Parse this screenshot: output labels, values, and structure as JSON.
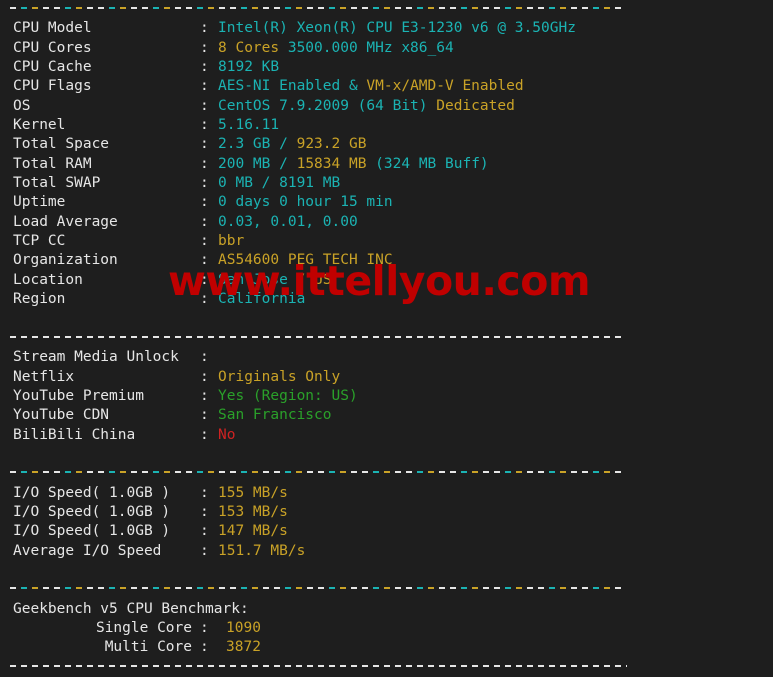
{
  "terminal": {
    "background": "#1e1e1e",
    "label_color": "#e6e6e6",
    "cyan": "#1bb3b3",
    "orange": "#c9a227",
    "green": "#2aa12a",
    "red": "#cf2222",
    "colon": ":"
  },
  "watermark": {
    "text": "www.ittellyou.com",
    "color": "#c00000"
  },
  "sysinfo": {
    "cpu_model": {
      "label": "CPU Model",
      "value": "Intel(R) Xeon(R) CPU E3-1230 v6 @ 3.50GHz"
    },
    "cpu_cores": {
      "label": "CPU Cores",
      "cores": "8 Cores",
      "freq": "3500.000 MHz x86_64"
    },
    "cpu_cache": {
      "label": "CPU Cache",
      "value": "8192 KB"
    },
    "cpu_flags": {
      "label": "CPU Flags",
      "aes": "AES-NI Enabled &",
      "vmx": " VM-x/AMD-V Enabled"
    },
    "os": {
      "label": "OS",
      "name": "CentOS 7.9.2009 (64 Bit)",
      "type": " Dedicated"
    },
    "kernel": {
      "label": "Kernel",
      "value": "5.16.11"
    },
    "total_space": {
      "label": "Total Space",
      "used": "2.3 GB",
      "slash": " / ",
      "total": "923.2 GB"
    },
    "total_ram": {
      "label": "Total RAM",
      "used": "200 MB",
      "slash": " / ",
      "total": "15834 MB",
      "buff": " (324 MB Buff)"
    },
    "total_swap": {
      "label": "Total SWAP",
      "value": "0 MB / 8191 MB"
    },
    "uptime": {
      "label": "Uptime",
      "value": "0 days 0 hour 15 min"
    },
    "load_average": {
      "label": "Load Average",
      "value": "0.03, 0.01, 0.00"
    },
    "tcp_cc": {
      "label": "TCP CC",
      "value": "bbr"
    },
    "organization": {
      "label": "Organization",
      "value": "AS54600 PEG TECH INC"
    },
    "location": {
      "label": "Location",
      "city": "San Jose",
      "slash": " / ",
      "country": "US"
    },
    "region": {
      "label": "Region",
      "value": "California"
    }
  },
  "stream_media": {
    "header": {
      "label": "Stream Media Unlock",
      "value": ""
    },
    "netflix": {
      "label": "Netflix",
      "value": "Originals Only"
    },
    "youtube_premium": {
      "label": "YouTube Premium",
      "value": "Yes (Region: US)"
    },
    "youtube_cdn": {
      "label": "YouTube CDN",
      "value": "San Francisco"
    },
    "bilibili_china": {
      "label": "BiliBili China",
      "value": "No"
    }
  },
  "io_speed": {
    "runs": [
      {
        "label": "I/O Speed( 1.0GB )",
        "value": "155 MB/s"
      },
      {
        "label": "I/O Speed( 1.0GB )",
        "value": "153 MB/s"
      },
      {
        "label": "I/O Speed( 1.0GB )",
        "value": "147 MB/s"
      }
    ],
    "average": {
      "label": "Average I/O Speed",
      "value": "151.7 MB/s"
    }
  },
  "geekbench": {
    "title": "Geekbench v5 CPU Benchmark:",
    "single_core": {
      "label": "Single Core",
      "value": "1090"
    },
    "multi_core": {
      "label": "Multi Core",
      "value": "3872"
    }
  }
}
